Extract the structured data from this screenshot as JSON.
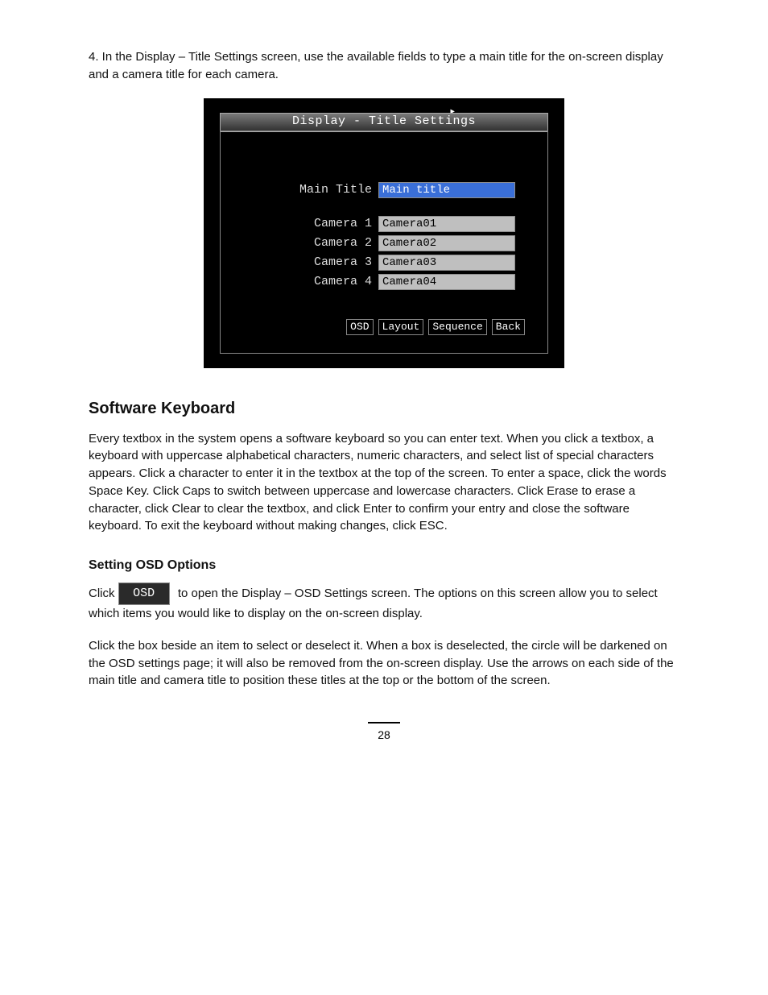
{
  "doc": {
    "intro_sentence": "4. In the Display – Title Settings screen, use the available fields to type a main title for the on-screen display and a camera title for each camera.",
    "figure_caption_before": "",
    "section_heading": "Software Keyboard",
    "section_para": "Every textbox in the system opens a software keyboard so you can enter text. When you click a textbox, a keyboard with uppercase alphabetical characters, numeric characters, and select list of special characters appears. Click a character to enter it in the textbox at the top of the screen. To enter a space, click the words Space Key. Click Caps to switch between uppercase and lowercase characters. Click Erase to erase a character, click Clear to clear the textbox, and click Enter to confirm your entry and close the software keyboard. To exit the keyboard without making changes, click ESC.",
    "sub_heading_osd": "Setting OSD Options",
    "osd_para_lead": "Click",
    "osd_para_rest": "to open the Display – OSD Settings screen. The options on this screen allow you to select which items you would like to display on the on-screen display.",
    "additional_explain": "Click the box beside an item to select or deselect it. When a box is deselected, the circle will be darkened on the OSD settings page; it will also be removed from the on-screen display. Use the arrows on each side of the main title and camera title to position these titles at the top or the bottom of the screen.",
    "page_number": "28",
    "osd_button_label": "OSD"
  },
  "dvr": {
    "title": "Display - Title Settings",
    "cursor_glyph": "▸",
    "fields": {
      "main_title_label": "Main Title",
      "main_title_value": "Main title",
      "cameras": [
        {
          "label": "Camera 1",
          "value": "Camera01"
        },
        {
          "label": "Camera 2",
          "value": "Camera02"
        },
        {
          "label": "Camera 3",
          "value": "Camera03"
        },
        {
          "label": "Camera 4",
          "value": "Camera04"
        }
      ]
    },
    "buttons": {
      "osd": "OSD",
      "layout": "Layout",
      "sequence": "Sequence",
      "back": "Back"
    }
  }
}
